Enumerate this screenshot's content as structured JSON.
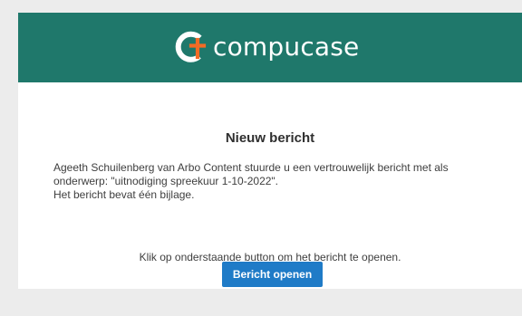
{
  "brand": {
    "name": "compucase",
    "logo_icon": "compucase-logo-icon",
    "header_color": "#1f786b",
    "accent_color": "#f36b25"
  },
  "email": {
    "title": "Nieuw bericht",
    "body_lines": [
      "Ageeth Schuilenberg van Arbo Content stuurde u een vertrouwelijk bericht met als",
      "onderwerp: \"uitnodiging spreekuur 1-10-2022\".",
      "Het bericht bevat één bijlage."
    ],
    "instruction": "Klik op onderstaande button om het bericht te openen.",
    "button_label": "Bericht openen",
    "button_color": "#1f7bc7"
  }
}
